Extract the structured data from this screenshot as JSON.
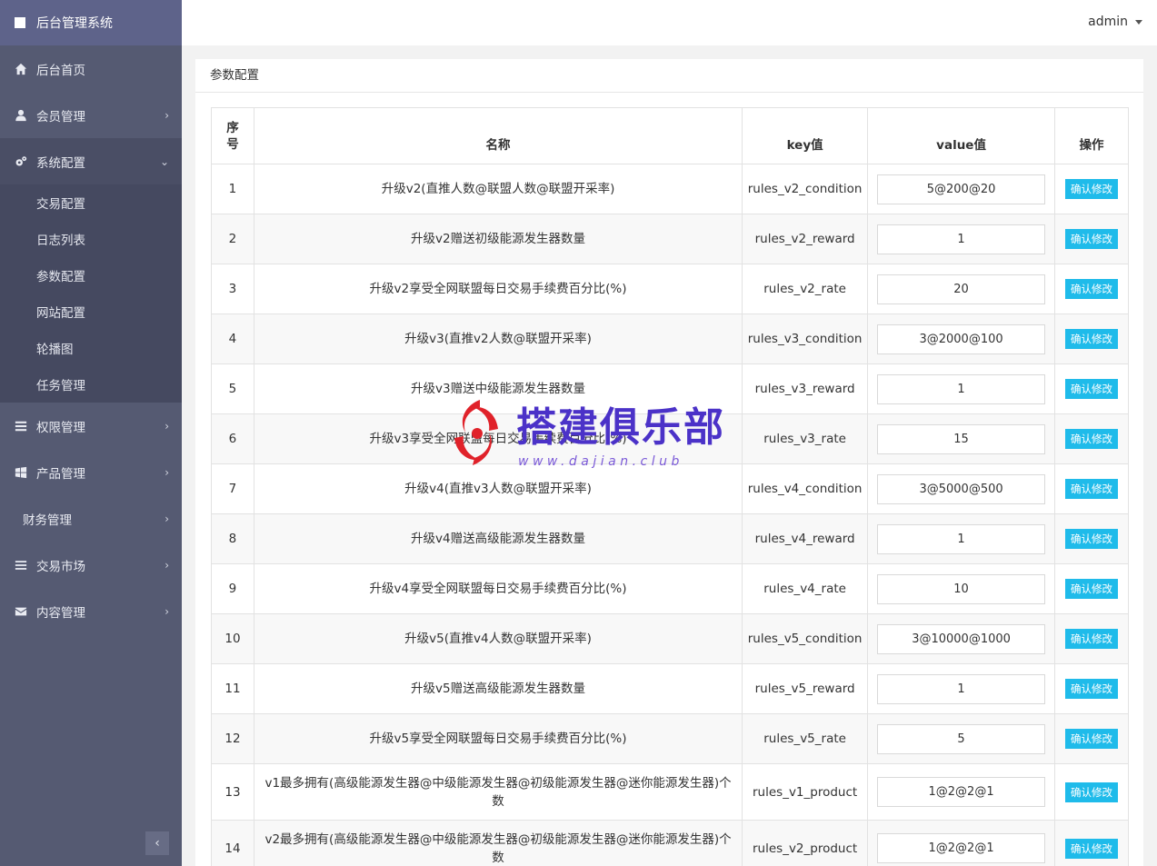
{
  "brand": {
    "title": "后台管理系统"
  },
  "header": {
    "user": "admin"
  },
  "sidebar": {
    "items": [
      {
        "label": "后台首页",
        "icon": "home-icon"
      },
      {
        "label": "会员管理",
        "icon": "user-icon"
      },
      {
        "label": "系统配置",
        "icon": "gears-icon"
      },
      {
        "label": "权限管理",
        "icon": "list-icon"
      },
      {
        "label": "产品管理",
        "icon": "windows-icon"
      },
      {
        "label": "财务管理",
        "icon": ""
      },
      {
        "label": "交易市场",
        "icon": "bars-icon"
      },
      {
        "label": "内容管理",
        "icon": "envelope-icon"
      }
    ],
    "submenu": [
      "交易配置",
      "日志列表",
      "参数配置",
      "网站配置",
      "轮播图",
      "任务管理"
    ]
  },
  "panel": {
    "title": "参数配置"
  },
  "table": {
    "headers": {
      "idx": [
        "序",
        "号"
      ],
      "name": "名称",
      "key": "key值",
      "value": "value值",
      "action": "操作"
    },
    "rows": [
      {
        "idx": "1",
        "name": "升级v2(直推人数@联盟人数@联盟开采率)",
        "key": "rules_v2_condition",
        "value": "5@200@20",
        "action": "确认修改"
      },
      {
        "idx": "2",
        "name": "升级v2赠送初级能源发生器数量",
        "key": "rules_v2_reward",
        "value": "1",
        "action": "确认修改"
      },
      {
        "idx": "3",
        "name": "升级v2享受全网联盟每日交易手续费百分比(%)",
        "key": "rules_v2_rate",
        "value": "20",
        "action": "确认修改"
      },
      {
        "idx": "4",
        "name": "升级v3(直推v2人数@联盟开采率)",
        "key": "rules_v3_condition",
        "value": "3@2000@100",
        "action": "确认修改"
      },
      {
        "idx": "5",
        "name": "升级v3赠送中级能源发生器数量",
        "key": "rules_v3_reward",
        "value": "1",
        "action": "确认修改"
      },
      {
        "idx": "6",
        "name": "升级v3享受全网联盟每日交易手续费百分比(%)",
        "key": "rules_v3_rate",
        "value": "15",
        "action": "确认修改"
      },
      {
        "idx": "7",
        "name": "升级v4(直推v3人数@联盟开采率)",
        "key": "rules_v4_condition",
        "value": "3@5000@500",
        "action": "确认修改"
      },
      {
        "idx": "8",
        "name": "升级v4赠送高级能源发生器数量",
        "key": "rules_v4_reward",
        "value": "1",
        "action": "确认修改"
      },
      {
        "idx": "9",
        "name": "升级v4享受全网联盟每日交易手续费百分比(%)",
        "key": "rules_v4_rate",
        "value": "10",
        "action": "确认修改"
      },
      {
        "idx": "10",
        "name": "升级v5(直推v4人数@联盟开采率)",
        "key": "rules_v5_condition",
        "value": "3@10000@1000",
        "action": "确认修改"
      },
      {
        "idx": "11",
        "name": "升级v5赠送高级能源发生器数量",
        "key": "rules_v5_reward",
        "value": "1",
        "action": "确认修改"
      },
      {
        "idx": "12",
        "name": "升级v5享受全网联盟每日交易手续费百分比(%)",
        "key": "rules_v5_rate",
        "value": "5",
        "action": "确认修改"
      },
      {
        "idx": "13",
        "name": "v1最多拥有(高级能源发生器@中级能源发生器@初级能源发生器@迷你能源发生器)个数",
        "key": "rules_v1_product",
        "value": "1@2@2@1",
        "action": "确认修改"
      },
      {
        "idx": "14",
        "name": "v2最多拥有(高级能源发生器@中级能源发生器@初级能源发生器@迷你能源发生器)个数",
        "key": "rules_v2_product",
        "value": "1@2@2@1",
        "action": "确认修改"
      }
    ]
  },
  "watermark": {
    "title": "搭建俱乐部",
    "url": "www.dajian.club"
  },
  "colors": {
    "sidebar": "#555a72",
    "brand": "#5e638a",
    "button": "#1fbbea"
  }
}
